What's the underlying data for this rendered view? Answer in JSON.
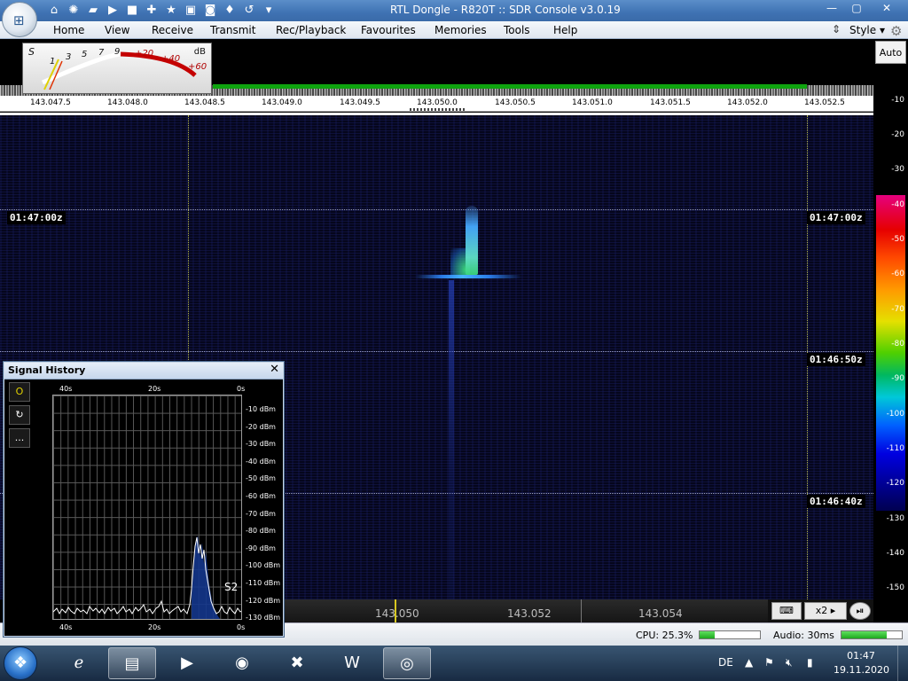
{
  "window": {
    "title": "RTL Dongle - R820T :: SDR Console v3.0.19",
    "qat_icons": [
      "home-icon",
      "settings-icon",
      "folder-icon",
      "play-icon",
      "stop-icon",
      "add-icon",
      "star-icon",
      "lock-icon",
      "camera-icon",
      "drop-icon",
      "undo-icon",
      "dropdown-icon"
    ]
  },
  "ribbon": {
    "tabs": [
      "Home",
      "View",
      "Receive",
      "Transmit",
      "Rec/Playback",
      "Favourites",
      "Memories",
      "Tools",
      "Help"
    ],
    "style_label": "Style"
  },
  "smeter": {
    "s_label": "S",
    "db_label": "dB",
    "ticks": [
      "1",
      "3",
      "5",
      "7",
      "9"
    ],
    "plus_ticks": [
      "+20",
      "+40",
      "+60"
    ]
  },
  "frequency_axis": [
    "143.047.5",
    "143.048.0",
    "143.048.5",
    "143.049.0",
    "143.049.5",
    "143.050.0",
    "143.050.5",
    "143.051.0",
    "143.051.5",
    "143.052.0",
    "143.052.5"
  ],
  "waterfall": {
    "timestamps": [
      "01:47:00z",
      "01:46:50z",
      "01:46:40z"
    ],
    "left_partial": "01:46:50"
  },
  "db_scale": {
    "auto_label": "Auto",
    "labels": [
      "-10",
      "-20",
      "-30",
      "-40",
      "-50",
      "-60",
      "-70",
      "-80",
      "-90",
      "-100",
      "-110",
      "-120",
      "-130",
      "-140",
      "-150"
    ]
  },
  "signal_history": {
    "title": "Signal History",
    "time_labels": [
      "40s",
      "20s",
      "0s"
    ],
    "y_labels": [
      "-10 dBm",
      "-20 dBm",
      "-30 dBm",
      "-40 dBm",
      "-50 dBm",
      "-60 dBm",
      "-70 dBm",
      "-80 dBm",
      "-90 dBm",
      "-100 dBm",
      "-110 dBm",
      "-120 dBm",
      "-130 dBm"
    ],
    "s_reading": "S2",
    "tool_labels": [
      "O",
      "↻",
      "..."
    ]
  },
  "bottom_strip": {
    "freqs": [
      "143.050",
      "143.052",
      "143.054"
    ],
    "zoom": "x2"
  },
  "status": {
    "cpu": "CPU: 25.3%",
    "cpu_fraction": 0.25,
    "audio": "Audio: 30ms",
    "audio_fraction": 0.75
  },
  "taskbar": {
    "apps": [
      "internet-explorer-icon",
      "file-explorer-icon",
      "media-player-icon",
      "chrome-icon",
      "excel-icon",
      "word-icon",
      "sdr-console-icon"
    ],
    "lang": "DE",
    "time": "01:47",
    "date": "19.11.2020"
  }
}
